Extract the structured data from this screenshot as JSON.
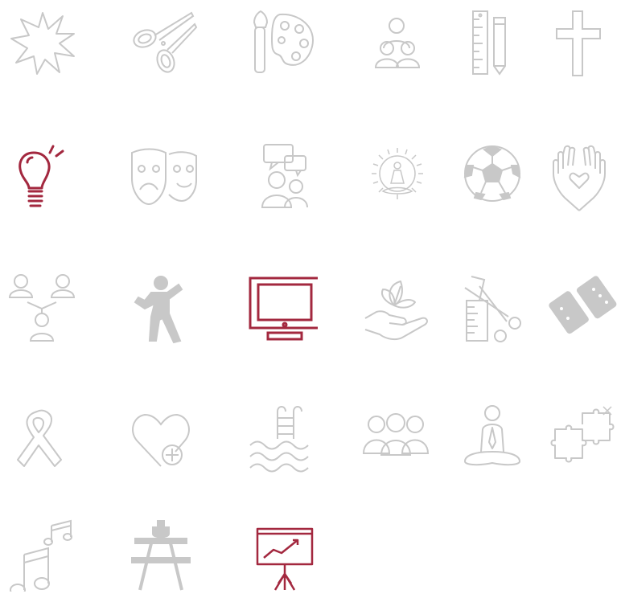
{
  "colors": {
    "inactive": "#c8c8c8",
    "active": "#a3283f",
    "background": "#ffffff"
  },
  "icons": [
    {
      "name": "starburst-icon",
      "state": "inactive"
    },
    {
      "name": "scissors-icon",
      "state": "inactive"
    },
    {
      "name": "paint-palette-icon",
      "state": "inactive"
    },
    {
      "name": "parent-child-icon",
      "state": "inactive"
    },
    {
      "name": "ruler-pencil-icon",
      "state": "inactive"
    },
    {
      "name": "cross-icon",
      "state": "inactive"
    },
    {
      "name": "light-bulb-icon",
      "state": "active"
    },
    {
      "name": "theater-masks-icon",
      "state": "inactive"
    },
    {
      "name": "discussion-icon",
      "state": "inactive"
    },
    {
      "name": "meditation-sun-icon",
      "state": "inactive"
    },
    {
      "name": "soccer-ball-icon",
      "state": "inactive"
    },
    {
      "name": "hands-heart-icon",
      "state": "inactive"
    },
    {
      "name": "group-network-icon",
      "state": "inactive"
    },
    {
      "name": "dancer-icon",
      "state": "inactive"
    },
    {
      "name": "television-icon",
      "state": "active"
    },
    {
      "name": "hand-plant-icon",
      "state": "inactive"
    },
    {
      "name": "tailoring-icon",
      "state": "inactive"
    },
    {
      "name": "dominoes-icon",
      "state": "inactive"
    },
    {
      "name": "awareness-ribbon-icon",
      "state": "inactive"
    },
    {
      "name": "heart-plus-icon",
      "state": "inactive"
    },
    {
      "name": "swimming-pool-icon",
      "state": "inactive"
    },
    {
      "name": "people-group-icon",
      "state": "inactive"
    },
    {
      "name": "yoga-icon",
      "state": "inactive"
    },
    {
      "name": "puzzle-icon",
      "state": "inactive"
    },
    {
      "name": "music-notes-icon",
      "state": "inactive"
    },
    {
      "name": "picnic-table-icon",
      "state": "inactive"
    },
    {
      "name": "presentation-board-icon",
      "state": "active"
    }
  ]
}
